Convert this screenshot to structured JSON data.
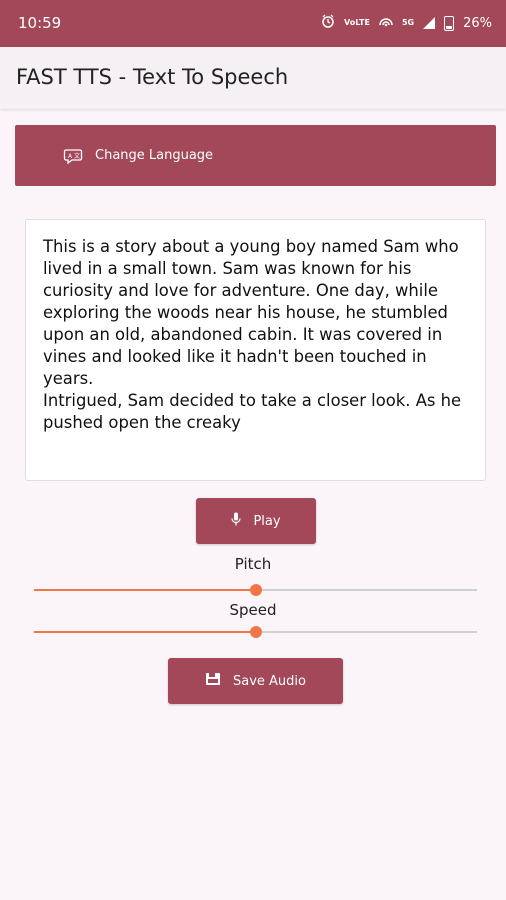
{
  "status_bar": {
    "time": "10:59",
    "net1": "VoLTE",
    "net2": "5G",
    "battery": "26%"
  },
  "app_bar": {
    "title": "FAST TTS - Text To Speech"
  },
  "change_language": {
    "label": "Change Language"
  },
  "text_input": {
    "value": "This is a story about a young boy named Sam who lived in a small town. Sam was known for his curiosity and love for adventure. One day, while exploring the woods near his house, he stumbled upon an old, abandoned cabin. It was covered in vines and looked like it hadn't been touched in years.\nIntrigued, Sam decided to take a closer look. As he pushed open the creaky"
  },
  "play": {
    "label": "Play"
  },
  "pitch": {
    "label": "Pitch",
    "value": 0.5
  },
  "speed": {
    "label": "Speed",
    "value": 0.5
  },
  "save_audio": {
    "label": "Save Audio"
  },
  "colors": {
    "primary": "#a24859",
    "accent": "#f07648",
    "background": "#fbf5f9"
  },
  "icons": {
    "lang": "translate-chat-icon",
    "play": "microphone-icon",
    "save": "save-disk-icon"
  }
}
